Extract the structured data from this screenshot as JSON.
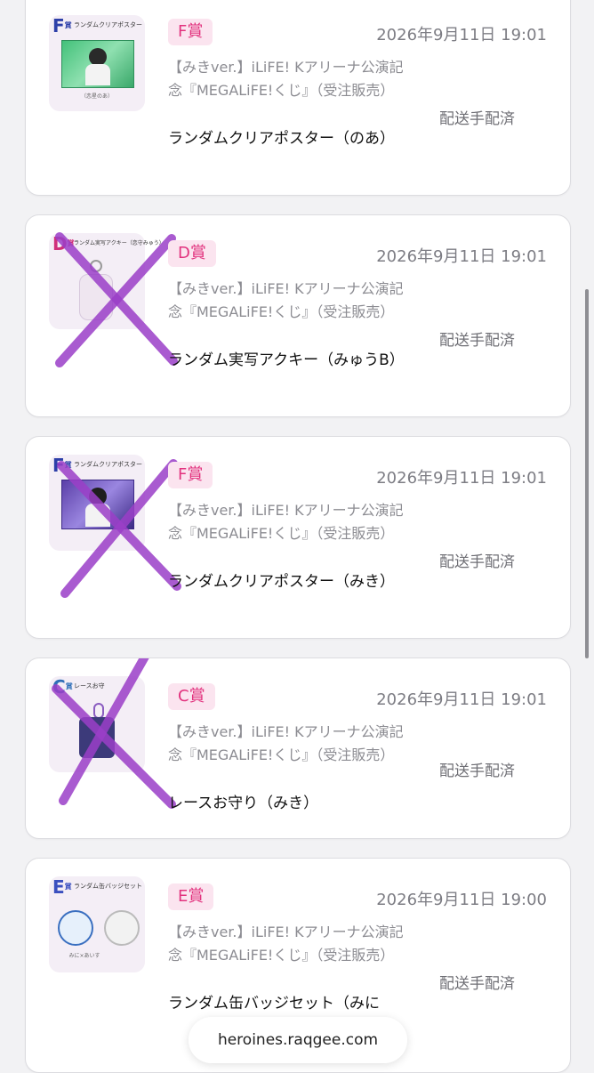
{
  "colors": {
    "badge_bg": "#fbe4ef",
    "badge_text": "#e2327e",
    "cross": "#9b3fc8"
  },
  "orders": [
    {
      "badge": "F賞",
      "date": "2026年9月11日 19:01",
      "desc": "【みきver.】iLiFE! Kアリーナ公演記念『MEGALiFE!くじ』（受注販売）",
      "item": "ランダムクリアポスター（のあ）",
      "status": "配送手配済",
      "thumb_code": "F",
      "thumb_title": "ランダムクリアポスター",
      "thumb_caption": "（恋星のあ）",
      "crossed": false
    },
    {
      "badge": "D賞",
      "date": "2026年9月11日 19:01",
      "desc": "【みきver.】iLiFE! Kアリーナ公演記念『MEGALiFE!くじ』（受注販売）",
      "item": "ランダム実写アクキー（みゅうB）",
      "status": "配送手配済",
      "thumb_code": "D",
      "thumb_title": "ランダム実写アクキー（恋守みゅう）",
      "crossed": true
    },
    {
      "badge": "F賞",
      "date": "2026年9月11日 19:01",
      "desc": "【みきver.】iLiFE! Kアリーナ公演記念『MEGALiFE!くじ』（受注販売）",
      "item": "ランダムクリアポスター（みき）",
      "status": "配送手配済",
      "thumb_code": "F",
      "thumb_title": "ランダムクリアポスター",
      "crossed": true
    },
    {
      "badge": "C賞",
      "date": "2026年9月11日 19:01",
      "desc": "【みきver.】iLiFE! Kアリーナ公演記念『MEGALiFE!くじ』（受注販売）",
      "item": "レースお守り（みき）",
      "status": "配送手配済",
      "thumb_code": "C",
      "thumb_title": "レースお守",
      "crossed": true
    },
    {
      "badge": "E賞",
      "date": "2026年9月11日 19:00",
      "desc": "【みきver.】iLiFE! Kアリーナ公演記念『MEGALiFE!くじ』（受注販売）",
      "item": "ランダム缶バッジセット（みに",
      "status": "配送手配済",
      "thumb_code": "E",
      "thumb_title": "ランダム缶バッジセット",
      "thumb_caption": "みに×あいす",
      "crossed": false
    }
  ],
  "browser": {
    "url": "heroines.raqgee.com"
  }
}
